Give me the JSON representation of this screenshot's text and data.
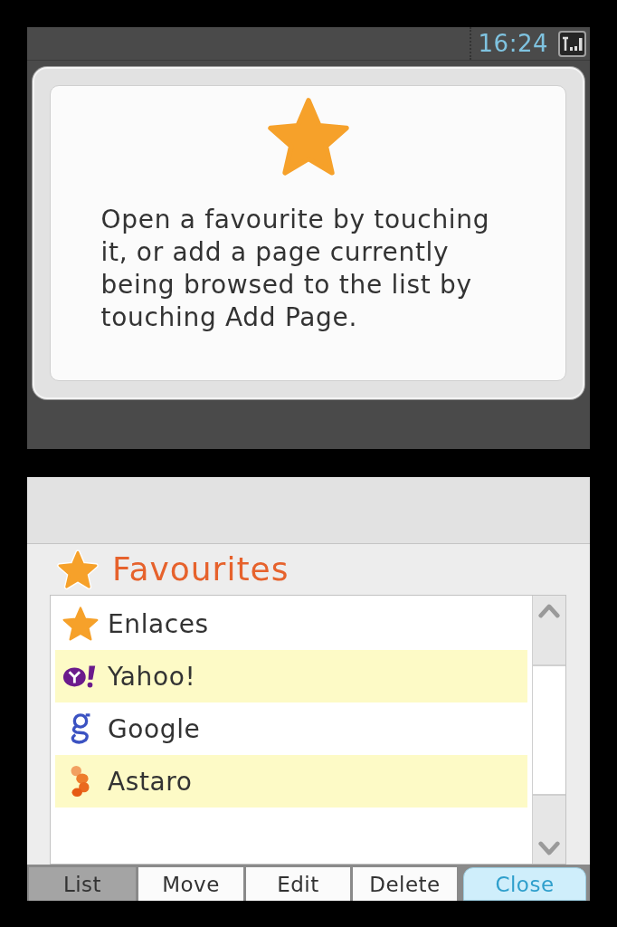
{
  "status_bar": {
    "time": "16:24"
  },
  "info_dialog": {
    "message": "Open a favourite by touching it, or add a page currently being browsed to the list by touching Add Page."
  },
  "favourites": {
    "title": "Favourites",
    "items": [
      {
        "label": "Enlaces",
        "kind": "star"
      },
      {
        "label": "Yahoo!",
        "kind": "badge"
      },
      {
        "label": "Google",
        "kind": "letter"
      },
      {
        "label": "Astaro",
        "kind": "blobs"
      }
    ]
  },
  "modes": [
    {
      "label": "List",
      "selected": true
    },
    {
      "label": "Move",
      "selected": false
    },
    {
      "label": "Edit",
      "selected": false
    },
    {
      "label": "Delete",
      "selected": false
    }
  ],
  "close_button": {
    "label": "Close"
  }
}
